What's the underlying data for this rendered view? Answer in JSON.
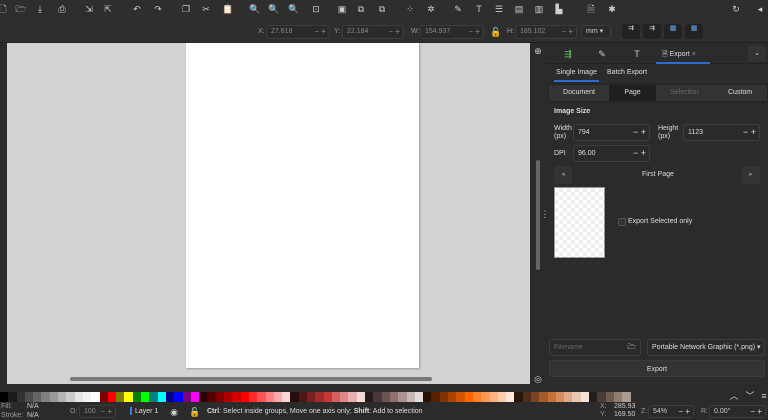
{
  "toolbar1": {
    "icons": [
      "new-icon",
      "open-icon",
      "save-icon",
      "print-icon",
      "import-icon",
      "export-icon",
      "undo-icon",
      "redo-icon",
      "duplicate-icon",
      "cut-icon",
      "paste-icon",
      "zoom-selection-icon",
      "zoom-drawing-icon",
      "zoom-page-icon",
      "zoom-fit-icon",
      "group-icon",
      "ungroup-icon",
      "clone-icon",
      "node-icon",
      "transform-icon",
      "fill-stroke-icon",
      "text-icon",
      "align-icon",
      "layers-icon",
      "objects-icon",
      "symbols-icon",
      "document-properties-icon",
      "preferences-icon"
    ]
  },
  "toolbar2": {
    "x_label": "X:",
    "x": "27.618",
    "y_label": "Y:",
    "y": "22.184",
    "w_label": "W:",
    "w": "154.937",
    "h_label": "H:",
    "h": "185.102",
    "unit": "mm"
  },
  "panel": {
    "tabs": [
      {
        "icon": "fill-icon"
      },
      {
        "icon": "stroke-icon"
      },
      {
        "icon": "text-icon"
      },
      {
        "label": "Export",
        "close": "×"
      }
    ],
    "subtabs": [
      "Single Image",
      "Batch Export"
    ],
    "modes": [
      "Document",
      "Page",
      "Selection",
      "Custom"
    ],
    "image_size": "Image Size",
    "width_label": "Width (px)",
    "width": "794",
    "height_label": "Height (px)",
    "height": "1123",
    "dpi_label": "DPI",
    "dpi": "96.00",
    "page_nav": "First Page",
    "export_selected": "Export Selected only",
    "filename_placeholder": "Filename",
    "format": "Portable Network Graphic (*.png)",
    "export_button": "Export"
  },
  "status": {
    "fill_label": "Fill:",
    "fill": "N/A",
    "stroke_label": "Stroke:",
    "stroke": "N/A",
    "opacity_label": "O:",
    "opacity": "100",
    "layer": "Layer 1",
    "message_bold1": "Ctrl",
    "message1": ": Select inside groups, Move one axis only; ",
    "message_bold2": "Shift",
    "message2": ": Add to selection",
    "cx_label": "X:",
    "cx": "285.93",
    "cy_label": "Y:",
    "cy": "169.50",
    "zoom_label": "Z:",
    "zoom": "54%",
    "rot_label": "R:",
    "rotation": "0.00°"
  },
  "palette": [
    "#000000",
    "#1a1a1a",
    "#333333",
    "#4d4d4d",
    "#666666",
    "#808080",
    "#999999",
    "#b3b3b3",
    "#cccccc",
    "#e6e6e6",
    "#f2f2f2",
    "#ffffff",
    "#800000",
    "#ff0000",
    "#808000",
    "#ffff00",
    "#008000",
    "#00ff00",
    "#008080",
    "#00ffff",
    "#000080",
    "#0000ff",
    "#800080",
    "#ff00ff",
    "#2b0000",
    "#550000",
    "#800000",
    "#aa0000",
    "#d40000",
    "#ff0000",
    "#ff2a2a",
    "#ff5555",
    "#ff8080",
    "#ffaaaa",
    "#ffd5d5",
    "#280b0b",
    "#501616",
    "#782121",
    "#a02c2c",
    "#c83737",
    "#d35f5f",
    "#de8787",
    "#e9afaf",
    "#f4d7d7",
    "#241c1c",
    "#483737",
    "#6c5353",
    "#916f6f",
    "#ac9393",
    "#c8b7b7",
    "#e3dbdb",
    "#2b1100",
    "#552200",
    "#803300",
    "#aa4400",
    "#d45500",
    "#ff6600",
    "#ff7f2a",
    "#ff9955",
    "#ffb380",
    "#ffccaa",
    "#ffe6d5",
    "#28170b",
    "#502d16",
    "#784421",
    "#a05a2c",
    "#c87137",
    "#d38d5f",
    "#deaa87",
    "#e9c6af",
    "#f4e3d7",
    "#241f1c",
    "#483e37",
    "#6c5d53",
    "#917c6f",
    "#ac9d93"
  ]
}
